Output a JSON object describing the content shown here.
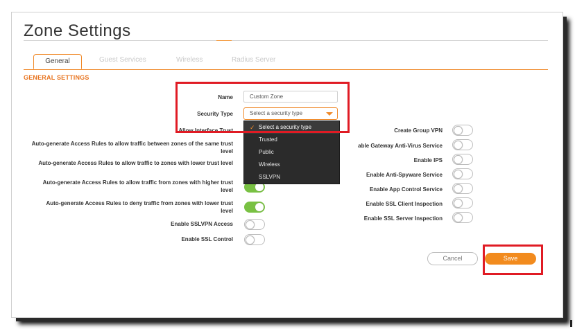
{
  "page": {
    "title": "Zone Settings",
    "accent_color": "#f08a2a",
    "highlight_color": "#e01b24",
    "toggle_on_color": "#79c143"
  },
  "tabs": [
    {
      "label": "General",
      "active": true
    },
    {
      "label": "Guest Services",
      "active": false
    },
    {
      "label": "Wireless",
      "active": false
    },
    {
      "label": "Radius Server",
      "active": false
    }
  ],
  "section": {
    "heading": "GENERAL SETTINGS"
  },
  "fields": {
    "name_label": "Name",
    "name_value": "Custom Zone",
    "security_type_label": "Security Type",
    "security_type_value": "Select a security type",
    "security_type_options": [
      "Select a security type",
      "Trusted",
      "Public",
      "Wireless",
      "SSLVPN"
    ]
  },
  "left_settings": [
    {
      "label": "Allow Interface Trust",
      "state": "hidden"
    },
    {
      "label": "Auto-generate Access Rules to allow traffic between zones of the same trust level",
      "state": "hidden"
    },
    {
      "label": "Auto-generate Access Rules to allow traffic to zones with lower trust level",
      "state": "hidden"
    },
    {
      "label": "Auto-generate Access Rules to allow traffic from zones with higher trust level",
      "state": "on"
    },
    {
      "label": "Auto-generate Access Rules to deny traffic from zones with lower trust level",
      "state": "on"
    },
    {
      "label": "Enable SSLVPN Access",
      "state": "off"
    },
    {
      "label": "Enable SSL Control",
      "state": "off"
    }
  ],
  "right_settings": [
    {
      "label": "Create Group VPN",
      "state": "off"
    },
    {
      "label": "able Gateway Anti-Virus Service",
      "state": "off"
    },
    {
      "label": "Enable IPS",
      "state": "off"
    },
    {
      "label": "Enable Anti-Spyware Service",
      "state": "off"
    },
    {
      "label": "Enable App Control Service",
      "state": "off"
    },
    {
      "label": "Enable SSL Client Inspection",
      "state": "off"
    },
    {
      "label": "Enable SSL Server Inspection",
      "state": "off"
    }
  ],
  "buttons": {
    "cancel": "Cancel",
    "save": "Save"
  }
}
